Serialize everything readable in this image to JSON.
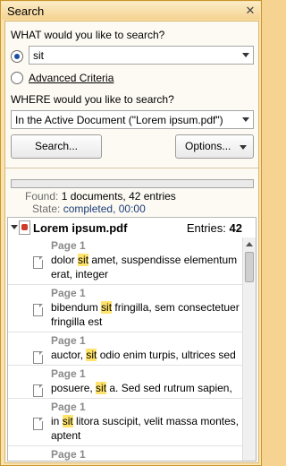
{
  "window": {
    "title": "Search",
    "close_glyph": "✕"
  },
  "what": {
    "label": "WHAT would you like to search?",
    "query_value": "sit",
    "advanced_label": "Advanced Criteria"
  },
  "where": {
    "label": "WHERE would you like to search?",
    "scope_value": "In the Active Document (\"Lorem ipsum.pdf\")"
  },
  "buttons": {
    "search_label": "Search...",
    "options_label": "Options..."
  },
  "status": {
    "found_key": "Found:",
    "found_value": "1 documents, 42 entries",
    "state_key": "State:",
    "state_value": "completed, 00:00"
  },
  "results": {
    "doc_name": "Lorem ipsum.pdf",
    "entries_label": "Entries:",
    "entries_count": "42",
    "items": [
      {
        "page": "Page 1",
        "before": "dolor ",
        "match": "sit",
        "after": " amet, suspendisse elementum erat, integer"
      },
      {
        "page": "Page 1",
        "before": "bibendum ",
        "match": "sit",
        "after": " fringilla, sem consectetuer fringilla est"
      },
      {
        "page": "Page 1",
        "before": "auctor, ",
        "match": "sit",
        "after": " odio enim turpis, ultrices sed"
      },
      {
        "page": "Page 1",
        "before": "posuere, ",
        "match": "sit",
        "after": " a. Sed sed rutrum sapien,"
      },
      {
        "page": "Page 1",
        "before": "in ",
        "match": "sit",
        "after": " litora suscipit, velit massa montes, aptent"
      },
      {
        "page": "Page 1",
        "before": "",
        "match": "",
        "after": ""
      }
    ]
  }
}
